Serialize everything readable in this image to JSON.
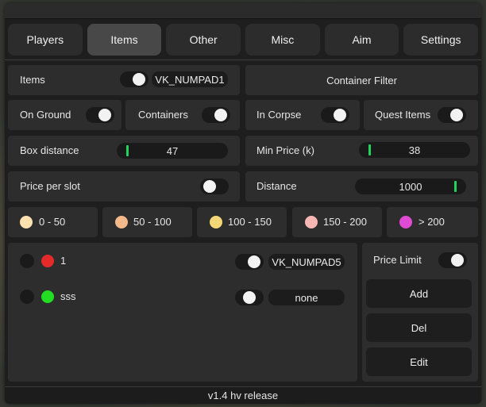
{
  "tabs": [
    "Players",
    "Items",
    "Other",
    "Misc",
    "Aim",
    "Settings"
  ],
  "active_tab": "Items",
  "items_row": {
    "label": "Items",
    "key": "VK_NUMPAD1",
    "container_filter": "Container Filter"
  },
  "filters": {
    "on_ground": "On Ground",
    "containers": "Containers",
    "in_corpse": "In Corpse",
    "quest_items": "Quest Items"
  },
  "box_distance": {
    "label": "Box distance",
    "value": "47",
    "fraction": 0.05
  },
  "min_price": {
    "label": "Min Price (k)",
    "value": "38",
    "fraction": 0.05
  },
  "price_per_slot": {
    "label": "Price per slot"
  },
  "distance": {
    "label": "Distance",
    "value": "1000",
    "fraction": 0.95
  },
  "price_ranges": [
    {
      "label": "0 - 50",
      "color": "#fde2b0"
    },
    {
      "label": "50 - 100",
      "color": "#f4b98a"
    },
    {
      "label": "100 - 150",
      "color": "#f6d777"
    },
    {
      "label": "150 - 200",
      "color": "#f8b7b4"
    },
    {
      "label": "> 200",
      "color": "#e04bd4"
    }
  ],
  "custom_items": [
    {
      "name": "1",
      "color": "#e52a2a",
      "key": "VK_NUMPAD5"
    },
    {
      "name": "sss",
      "color": "#22dd22",
      "key": "none"
    }
  ],
  "side": {
    "price_limit": "Price Limit",
    "add": "Add",
    "del": "Del",
    "edit": "Edit"
  },
  "footer": "v1.4 hv release"
}
